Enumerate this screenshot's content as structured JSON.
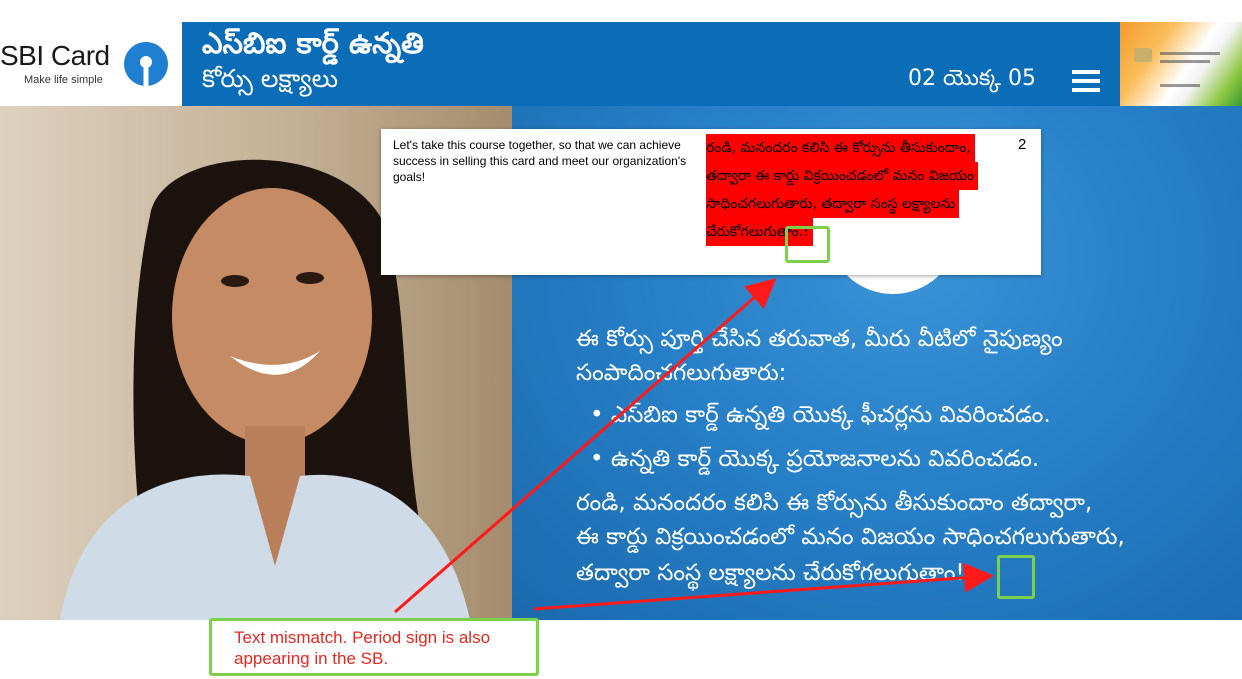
{
  "logo": {
    "brand": "SBI Card",
    "tagline": "Make life simple"
  },
  "header": {
    "title": "ఎస్‌బిఐ కార్డ్ ఉన్నతి",
    "subtitle": "కోర్సు లక్ష్యాలు",
    "page_indicator": "02 యొక్క 05"
  },
  "comment": {
    "english": "Let's take this course together, so that we can achieve success in selling this card and meet our organization's goals!",
    "telugu_lines": [
      "రండి, మనందరం కలిసి ఈ కోర్సును తీసుకుందాం,",
      "తద్వారా ఈ కార్డు విక్రయించడంలో మనం విజయం",
      "సాధించగలుగుతారు, తద్వారా సంస్థ లక్ష్యాలను",
      "చేరుకోగలుగుతాం.!"
    ],
    "number": "2"
  },
  "main": {
    "intro_line1": "ఈ కోర్సు పూర్తి చేసిన తరువాత, మీరు వీటిలో నైపుణ్యం",
    "intro_line2": "సంపాదించగలుగుతారు:",
    "bullet1": "• ఎస్‌బిఐ కార్డ్ ఉన్నతి యొక్క ఫీచర్లను వివరించడం.",
    "bullet2": "• ఉన్నతి కార్డ్ యొక్క ప్రయోజనాలను వివరించడం.",
    "closing_line1": "రండి, మనందరం కలిసి ఈ కోర్సును తీసుకుందాం తద్వారా,",
    "closing_line2": "ఈ కార్డు విక్రయించడంలో మనం విజయం సాధించగలుగుతారు,",
    "closing_line3": "తద్వారా సంస్థ లక్ష్యాలను చేరుకోగలుగుతాం!"
  },
  "annotation": {
    "line1": "Text mismatch. Period sign is also",
    "line2": "appearing in the SB.",
    "color": "#e8271e",
    "highlight_color": "#7cd14a"
  },
  "colors": {
    "header_blue": "#0b6cb7",
    "comment_highlight": "#ff0000"
  }
}
